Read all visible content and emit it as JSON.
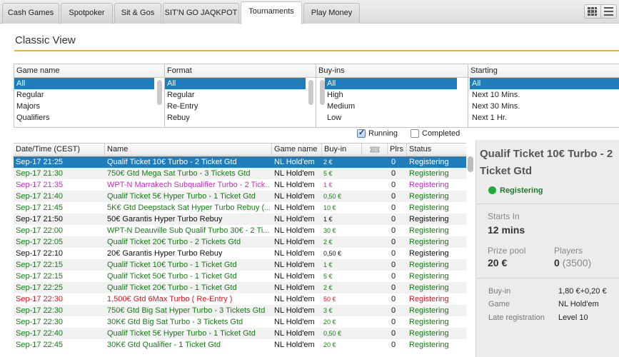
{
  "tabs": [
    {
      "label": "Cash Games",
      "active": false
    },
    {
      "label": "Spotpoker",
      "active": false
    },
    {
      "label": "Sit & Gos",
      "active": false
    },
    {
      "label": "SIT'N GO JAQKPOT",
      "active": false
    },
    {
      "label": "Tournaments",
      "active": true
    },
    {
      "label": "Play Money",
      "active": false
    }
  ],
  "heading": "Classic View",
  "filters": {
    "game_name": {
      "header": "Game name",
      "options": [
        "All",
        "Regular",
        "Majors",
        "Qualifiers"
      ],
      "selected": "All"
    },
    "format": {
      "header": "Format",
      "options": [
        "All",
        "Regular",
        "Re-Entry",
        "Rebuy"
      ],
      "selected": "All"
    },
    "buyins": {
      "header": "Buy-ins",
      "options": [
        "All",
        "High",
        "Medium",
        "Low"
      ],
      "selected": "All"
    },
    "starting": {
      "header": "Starting",
      "options": [
        "All",
        "Next 10 Mins.",
        "Next 30 Mins.",
        "Next 1 Hr."
      ],
      "selected": "All"
    }
  },
  "toggles": {
    "running": {
      "label": "Running",
      "checked": true
    },
    "completed": {
      "label": "Completed",
      "checked": false
    }
  },
  "table": {
    "headers": {
      "datetime": "Date/Time (CEST)",
      "name": "Name",
      "game": "Game name",
      "buyin": "Buy-in",
      "ticket_icon": "ticket-icon",
      "plrs": "Plrs",
      "status": "Status"
    },
    "rows": [
      {
        "datetime": "Sep-17 21:25",
        "name": "Qualif Ticket 10€ Turbo - 2 Ticket Gtd",
        "game": "NL Hold'em",
        "buyin": "2 €",
        "plrs": "0",
        "status": "Registering",
        "color": "green",
        "selected": true
      },
      {
        "datetime": "Sep-17 21:30",
        "name": "750€ Gtd Mega Sat Turbo - 3 Tickets Gtd",
        "game": "NL Hold'em",
        "buyin": "5 €",
        "plrs": "0",
        "status": "Registering",
        "color": "green",
        "selected": false
      },
      {
        "datetime": "Sep-17 21:35",
        "name": "WPT-N Marrakech Subqualifier Turbo - 2 Tick...",
        "game": "NL Hold'em",
        "buyin": "1 €",
        "plrs": "0",
        "status": "Registering",
        "color": "pink",
        "selected": false
      },
      {
        "datetime": "Sep-17 21:40",
        "name": "Qualif Ticket 5€ Hyper Turbo - 1 Ticket Gtd",
        "game": "NL Hold'em",
        "buyin": "0,50 €",
        "plrs": "0",
        "status": "Registering",
        "color": "green",
        "selected": false
      },
      {
        "datetime": "Sep-17 21:45",
        "name": "5K€ Gtd Deepstack Sat Hyper Turbo Rebuy (...",
        "game": "NL Hold'em",
        "buyin": "10 €",
        "plrs": "0",
        "status": "Registering",
        "color": "green",
        "selected": false
      },
      {
        "datetime": "Sep-17 21:50",
        "name": "50€ Garantis Hyper Turbo Rebuy",
        "game": "NL Hold'em",
        "buyin": "1 €",
        "plrs": "0",
        "status": "Registering",
        "color": "black",
        "selected": false
      },
      {
        "datetime": "Sep-17 22:00",
        "name": "WPT-N Deauville Sub Qualif Turbo 30€ - 2 Ti...",
        "game": "NL Hold'em",
        "buyin": "30 €",
        "plrs": "0",
        "status": "Registering",
        "color": "green",
        "selected": false
      },
      {
        "datetime": "Sep-17 22:05",
        "name": "Qualif Ticket 20€ Turbo - 2 Tickets Gtd",
        "game": "NL Hold'em",
        "buyin": "2 €",
        "plrs": "0",
        "status": "Registering",
        "color": "green",
        "selected": false
      },
      {
        "datetime": "Sep-17 22:10",
        "name": "20€ Garantis Hyper Turbo Rebuy",
        "game": "NL Hold'em",
        "buyin": "0,50 €",
        "plrs": "0",
        "status": "Registering",
        "color": "black",
        "selected": false
      },
      {
        "datetime": "Sep-17 22:15",
        "name": "Qualif Ticket 10€ Turbo - 1 Ticket Gtd",
        "game": "NL Hold'em",
        "buyin": "1 €",
        "plrs": "0",
        "status": "Registering",
        "color": "green",
        "selected": false
      },
      {
        "datetime": "Sep-17 22:15",
        "name": "Qualif Ticket 50€ Turbo - 1 Ticket Gtd",
        "game": "NL Hold'em",
        "buyin": "5 €",
        "plrs": "0",
        "status": "Registering",
        "color": "green",
        "selected": false
      },
      {
        "datetime": "Sep-17 22:25",
        "name": "Qualif Ticket 20€ Turbo - 1 Ticket Gtd",
        "game": "NL Hold'em",
        "buyin": "2 €",
        "plrs": "0",
        "status": "Registering",
        "color": "green",
        "selected": false
      },
      {
        "datetime": "Sep-17 22:30",
        "name": "1,500€ Gtd 6Max Turbo ( Re-Entry )",
        "game": "NL Hold'em",
        "buyin": "50 €",
        "plrs": "0",
        "status": "Registering",
        "color": "red",
        "selected": false
      },
      {
        "datetime": "Sep-17 22:30",
        "name": "750€ Gtd Big Sat Hyper Turbo - 3 Tickets Gtd",
        "game": "NL Hold'em",
        "buyin": "3 €",
        "plrs": "0",
        "status": "Registering",
        "color": "green",
        "selected": false
      },
      {
        "datetime": "Sep-17 22:30",
        "name": "30K€ Gtd Big Sat Turbo - 3 Tickets Gtd",
        "game": "NL Hold'em",
        "buyin": "20 €",
        "plrs": "0",
        "status": "Registering",
        "color": "green",
        "selected": false
      },
      {
        "datetime": "Sep-17 22:40",
        "name": "Qualif Ticket 5€ Hyper Turbo - 1 Ticket Gtd",
        "game": "NL Hold'em",
        "buyin": "0,50 €",
        "plrs": "0",
        "status": "Registering",
        "color": "green",
        "selected": false
      },
      {
        "datetime": "Sep-17 22:45",
        "name": "30K€ Gtd Qualifier - 1 Ticket Gtd",
        "game": "NL Hold'em",
        "buyin": "20 €",
        "plrs": "0",
        "status": "Registering",
        "color": "green",
        "selected": false
      }
    ]
  },
  "detail": {
    "title": "Qualif Ticket 10€ Turbo - 2 Ticket Gtd",
    "status": "Registering",
    "starts_in_label": "Starts In",
    "starts_in_value": "12 mins",
    "prize_pool_label": "Prize pool",
    "prize_pool_value": "20 €",
    "players_label": "Players",
    "players_value": "0",
    "players_max": "(3500)",
    "buyin_label": "Buy-in",
    "buyin_value": "1,80 €+0,20 €",
    "game_label": "Game",
    "game_value": "NL Hold'em",
    "late_reg_label": "Late registration",
    "late_reg_value": "Level 10"
  },
  "colors": {
    "accent_line": "#efb41b",
    "selection": "#1e7dba",
    "green_text": "#157c15",
    "pink_text": "#c62bc6",
    "red_text": "#e0141a",
    "status_dot": "#22a93a"
  }
}
